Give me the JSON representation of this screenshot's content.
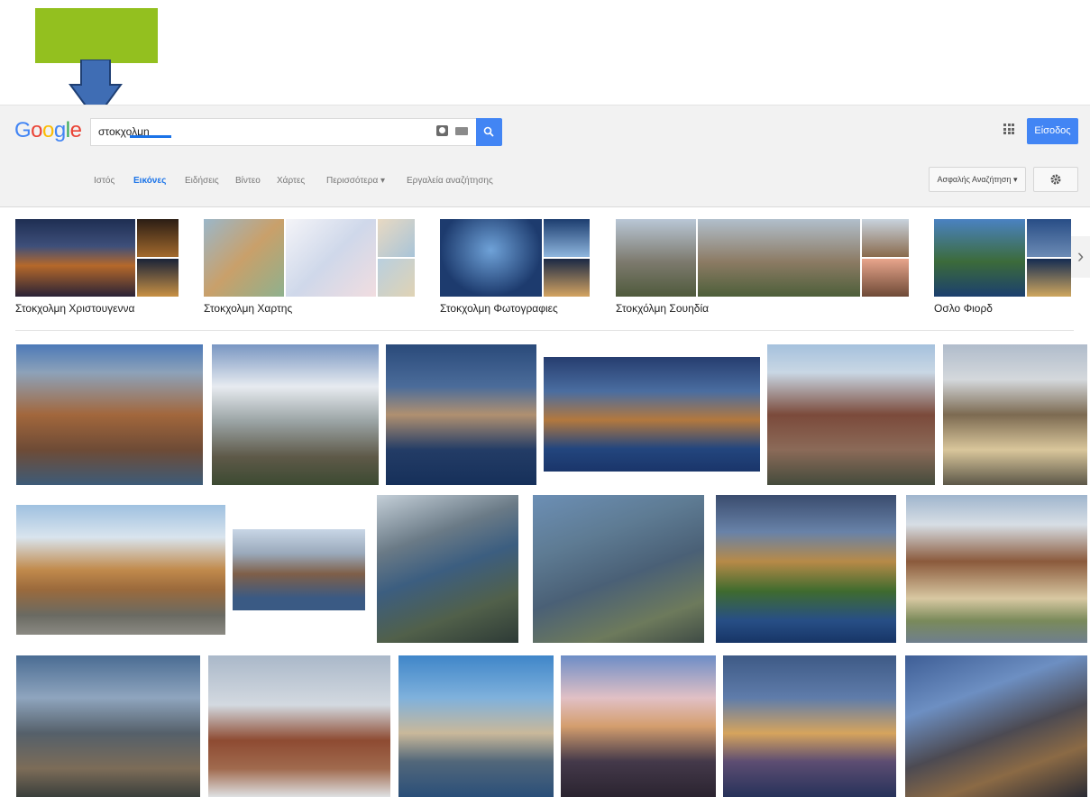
{
  "search": {
    "query": "στοκχολμη"
  },
  "header": {
    "logo_letters": [
      "G",
      "o",
      "o",
      "g",
      "l",
      "e"
    ],
    "logo_colors": [
      "#4285f4",
      "#ea4335",
      "#fbbc05",
      "#4285f4",
      "#34a853",
      "#ea4335"
    ],
    "signin_label": "Είσοδος"
  },
  "tabs": [
    {
      "label": "Ιστός"
    },
    {
      "label": "Εικόνες"
    },
    {
      "label": "Ειδήσεις"
    },
    {
      "label": "Βίντεο"
    },
    {
      "label": "Χάρτες"
    },
    {
      "label": "Περισσότερα ▾"
    },
    {
      "label": "Εργαλεία αναζήτησης"
    }
  ],
  "tools": {
    "safe_search_label": "Ασφαλής Αναζήτηση ▾"
  },
  "related": [
    {
      "label": "Στοκχολμη Χριστουγεννα"
    },
    {
      "label": "Στοκχολμη Χαρτης"
    },
    {
      "label": "Στοκχολμη Φωτογραφιες"
    },
    {
      "label": "Στοκχόλμη Σουηδία"
    },
    {
      "label": "Οσλο Φιορδ"
    }
  ],
  "colors": {
    "accent": "#4285f4",
    "annotation_green": "#93c01f",
    "annotation_arrow": "#3f6db4"
  }
}
